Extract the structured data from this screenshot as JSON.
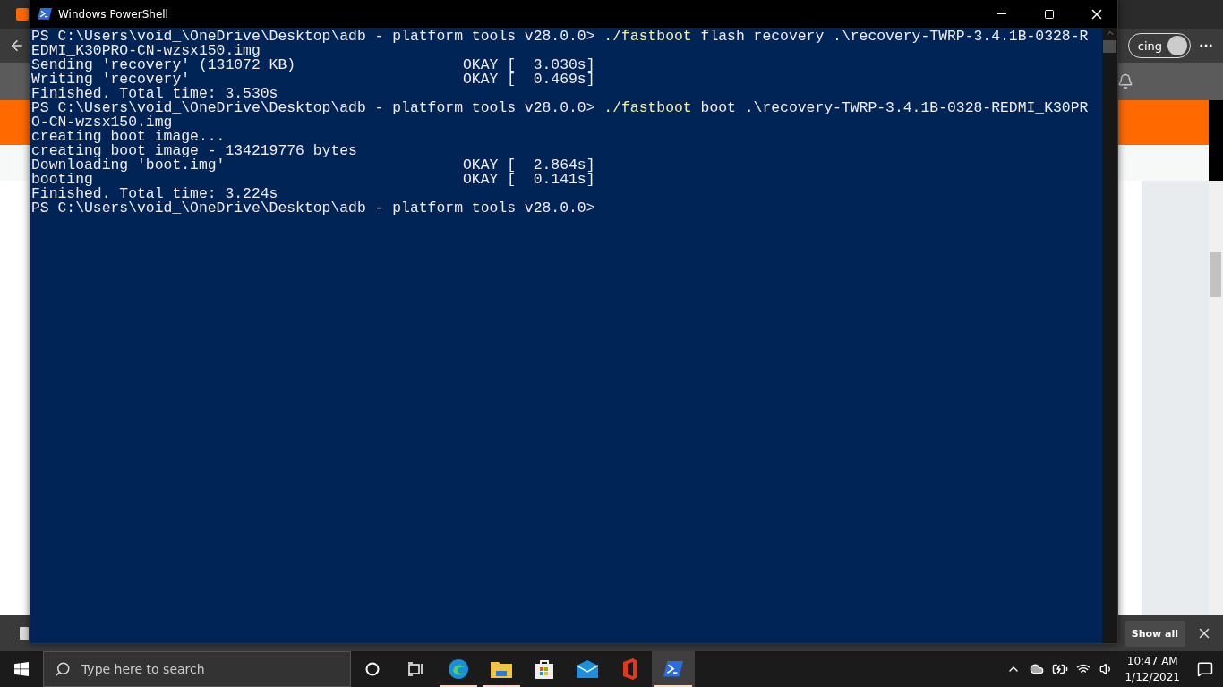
{
  "background_browser": {
    "profile_label": "cing",
    "download_bar": {
      "button": "Show all"
    }
  },
  "window": {
    "title": "Windows PowerShell",
    "lines": [
      {
        "kind": "command",
        "prompt": "PS C:\\Users\\void_\\OneDrive\\Desktop\\adb - platform tools v28.0.0> ",
        "command": "./fastboot",
        "args": " flash recovery .\\recovery-TWRP-3.4.1B-0328-R"
      },
      {
        "kind": "output",
        "text": "EDMI_K30PRO-CN-wzsx150.img"
      },
      {
        "kind": "output",
        "text": "Sending 'recovery' (131072 KB)",
        "status": "OKAY [  3.030s]"
      },
      {
        "kind": "output",
        "text": "Writing 'recovery'",
        "status": "OKAY [  0.469s]"
      },
      {
        "kind": "output",
        "text": "Finished. Total time: 3.530s"
      },
      {
        "kind": "command",
        "prompt": "PS C:\\Users\\void_\\OneDrive\\Desktop\\adb - platform tools v28.0.0> ",
        "command": "./fastboot",
        "args": " boot .\\recovery-TWRP-3.4.1B-0328-REDMI_K30PR"
      },
      {
        "kind": "output",
        "text": "O-CN-wzsx150.img"
      },
      {
        "kind": "output",
        "text": "creating boot image..."
      },
      {
        "kind": "output",
        "text": "creating boot image - 134219776 bytes"
      },
      {
        "kind": "output",
        "text": "Downloading 'boot.img'",
        "status": "OKAY [  2.864s]"
      },
      {
        "kind": "output",
        "text": "booting",
        "status": "OKAY [  0.141s]"
      },
      {
        "kind": "output",
        "text": "Finished. Total time: 3.224s"
      },
      {
        "kind": "prompt",
        "prompt": "PS C:\\Users\\void_\\OneDrive\\Desktop\\adb - platform tools v28.0.0>"
      }
    ]
  },
  "taskbar": {
    "search": {
      "placeholder": "Type here to search"
    },
    "apps": [
      {
        "kind": "edge",
        "running": true,
        "selected": false
      },
      {
        "kind": "explorer",
        "running": true,
        "selected": false
      },
      {
        "kind": "store",
        "running": false,
        "selected": false
      },
      {
        "kind": "mail",
        "running": false,
        "selected": false
      },
      {
        "kind": "office",
        "running": false,
        "selected": false
      },
      {
        "kind": "powershell",
        "running": true,
        "selected": true
      }
    ],
    "clock": {
      "time": "10:47 AM",
      "date": "1/12/2021"
    }
  }
}
